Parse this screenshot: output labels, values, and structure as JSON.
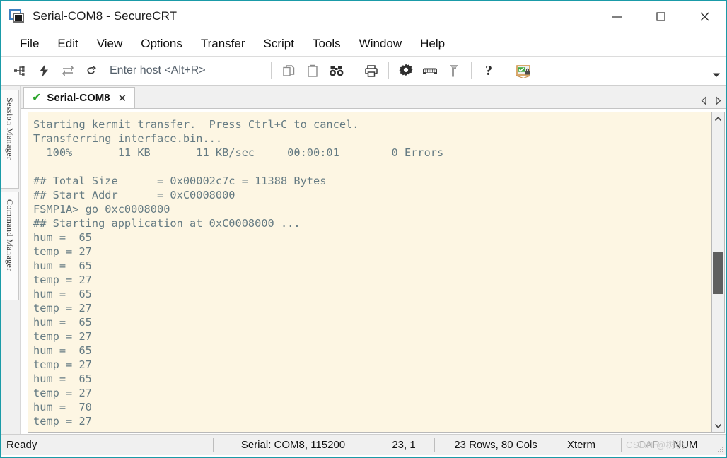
{
  "window": {
    "title": "Serial-COM8 - SecureCRT",
    "icon": "securecrt-app-icon",
    "minimize_label": "—",
    "maximize_label": "□",
    "close_label": "✕"
  },
  "menubar": {
    "items": [
      {
        "label": "File"
      },
      {
        "label": "Edit"
      },
      {
        "label": "View"
      },
      {
        "label": "Options"
      },
      {
        "label": "Transfer"
      },
      {
        "label": "Script"
      },
      {
        "label": "Tools"
      },
      {
        "label": "Window"
      },
      {
        "label": "Help"
      }
    ]
  },
  "toolbar": {
    "host_placeholder": "Enter host <Alt+R>",
    "host_value": "",
    "icons": [
      {
        "name": "connect-icon",
        "title": "Connect"
      },
      {
        "name": "quick-connect-icon",
        "title": "Quick Connect"
      },
      {
        "name": "reconnect-icon",
        "title": "Reconnect"
      },
      {
        "name": "disconnect-icon",
        "title": "Disconnect"
      },
      {
        "name": "copy-icon",
        "title": "Copy"
      },
      {
        "name": "paste-icon",
        "title": "Paste"
      },
      {
        "name": "find-icon",
        "title": "Find"
      },
      {
        "name": "print-icon",
        "title": "Print"
      },
      {
        "name": "settings-gear-icon",
        "title": "Session Options"
      },
      {
        "name": "keyboard-icon",
        "title": "Keymap Editor"
      },
      {
        "name": "key-icon",
        "title": "Public Key"
      },
      {
        "name": "help-icon",
        "title": "Help"
      },
      {
        "name": "session-security-icon",
        "title": "Session Security"
      }
    ],
    "overflow_label": "▾"
  },
  "sidebar": {
    "tabs": [
      {
        "label": "Session Manager"
      },
      {
        "label": "Command Manager"
      }
    ]
  },
  "tabstrip": {
    "tabs": [
      {
        "label": "Serial-COM8",
        "status_icon": "green-check-icon",
        "check_glyph": "✔",
        "close_glyph": "✕",
        "active": true
      }
    ],
    "nav_prev": "previous-tab",
    "nav_next": "next-tab"
  },
  "terminal": {
    "background_color": "#fdf6e3",
    "text_color": "#657b83",
    "content": "Starting kermit transfer.  Press Ctrl+C to cancel.\nTransferring interface.bin...\n  100%       11 KB       11 KB/sec     00:00:01        0 Errors\n\n## Total Size      = 0x00002c7c = 11388 Bytes\n## Start Addr      = 0xC0008000\nFSMP1A> go 0xc0008000\n## Starting application at 0xC0008000 ...\nhum =  65\ntemp = 27\nhum =  65\ntemp = 27\nhum =  65\ntemp = 27\nhum =  65\ntemp = 27\nhum =  65\ntemp = 27\nhum =  65\ntemp = 27\nhum =  70\ntemp = 27",
    "scrollbar": {
      "up_arrow": "∧",
      "down_arrow": "∨",
      "thumb_position_percent": 58
    }
  },
  "statusbar": {
    "status": "Ready",
    "connection": "Serial: COM8, 115200",
    "cursor_position": "23,  1",
    "dimensions": "23 Rows, 80 Cols",
    "emulation": "Xterm",
    "caps_indicator": "CAP",
    "num_indicator": "NUM",
    "watermark": "CSDN @树桃"
  }
}
